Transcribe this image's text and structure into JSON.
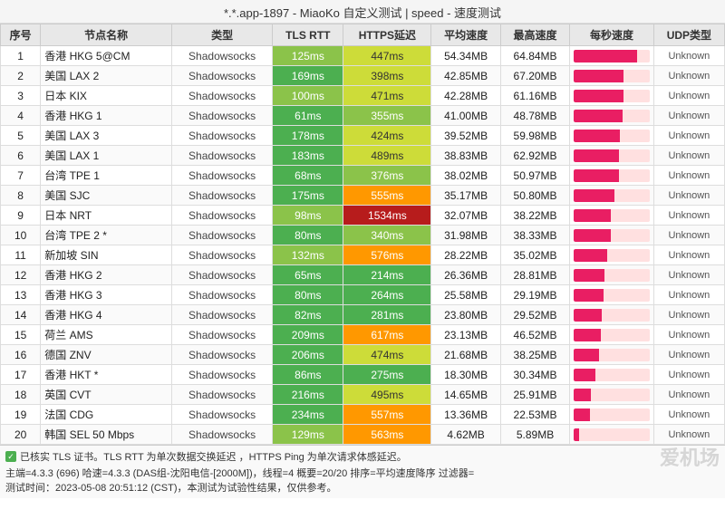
{
  "title": "*.*.app-1897 - MiaoKo 自定义测试 | speed - 速度测试",
  "columns": [
    "序号",
    "节点名称",
    "类型",
    "TLS RTT",
    "HTTPS延迟",
    "平均速度",
    "最高速度",
    "每秒速度",
    "UDP类型"
  ],
  "rows": [
    {
      "id": 1,
      "name": "香港 HKG 5@CM",
      "type": "Shadowsocks",
      "tls": "125ms",
      "tls_class": "tls-lightgreen",
      "https": "447ms",
      "https_class": "https-yellow",
      "avg": "54.34MB",
      "max": "64.84MB",
      "bar_pct": 84,
      "udp": "Unknown"
    },
    {
      "id": 2,
      "name": "美国 LAX 2",
      "type": "Shadowsocks",
      "tls": "169ms",
      "tls_class": "tls-green",
      "https": "398ms",
      "https_class": "https-yellow",
      "avg": "42.85MB",
      "max": "67.20MB",
      "bar_pct": 66,
      "udp": "Unknown"
    },
    {
      "id": 3,
      "name": "日本 KIX",
      "type": "Shadowsocks",
      "tls": "100ms",
      "tls_class": "tls-lightgreen",
      "https": "471ms",
      "https_class": "https-yellow",
      "avg": "42.28MB",
      "max": "61.16MB",
      "bar_pct": 65,
      "udp": "Unknown"
    },
    {
      "id": 4,
      "name": "香港 HKG 1",
      "type": "Shadowsocks",
      "tls": "61ms",
      "tls_class": "tls-green",
      "https": "355ms",
      "https_class": "https-lightgreen",
      "avg": "41.00MB",
      "max": "48.78MB",
      "bar_pct": 64,
      "udp": "Unknown"
    },
    {
      "id": 5,
      "name": "美国 LAX 3",
      "type": "Shadowsocks",
      "tls": "178ms",
      "tls_class": "tls-green",
      "https": "424ms",
      "https_class": "https-yellow",
      "avg": "39.52MB",
      "max": "59.98MB",
      "bar_pct": 61,
      "udp": "Unknown"
    },
    {
      "id": 6,
      "name": "美国 LAX 1",
      "type": "Shadowsocks",
      "tls": "183ms",
      "tls_class": "tls-green",
      "https": "489ms",
      "https_class": "https-yellow",
      "avg": "38.83MB",
      "max": "62.92MB",
      "bar_pct": 60,
      "udp": "Unknown"
    },
    {
      "id": 7,
      "name": "台湾 TPE 1",
      "type": "Shadowsocks",
      "tls": "68ms",
      "tls_class": "tls-green",
      "https": "376ms",
      "https_class": "https-lightgreen",
      "avg": "38.02MB",
      "max": "50.97MB",
      "bar_pct": 59,
      "udp": "Unknown"
    },
    {
      "id": 8,
      "name": "美国 SJC",
      "type": "Shadowsocks",
      "tls": "175ms",
      "tls_class": "tls-green",
      "https": "555ms",
      "https_class": "https-orange",
      "avg": "35.17MB",
      "max": "50.80MB",
      "bar_pct": 54,
      "udp": "Unknown"
    },
    {
      "id": 9,
      "name": "日本 NRT",
      "type": "Shadowsocks",
      "tls": "98ms",
      "tls_class": "tls-lightgreen",
      "https": "1534ms",
      "https_class": "https-darkred",
      "avg": "32.07MB",
      "max": "38.22MB",
      "bar_pct": 49,
      "udp": "Unknown"
    },
    {
      "id": 10,
      "name": "台湾 TPE 2 *",
      "type": "Shadowsocks",
      "tls": "80ms",
      "tls_class": "tls-green",
      "https": "340ms",
      "https_class": "https-lightgreen",
      "avg": "31.98MB",
      "max": "38.33MB",
      "bar_pct": 49,
      "udp": "Unknown"
    },
    {
      "id": 11,
      "name": "新加坡 SIN",
      "type": "Shadowsocks",
      "tls": "132ms",
      "tls_class": "tls-lightgreen",
      "https": "576ms",
      "https_class": "https-orange",
      "avg": "28.22MB",
      "max": "35.02MB",
      "bar_pct": 44,
      "udp": "Unknown"
    },
    {
      "id": 12,
      "name": "香港 HKG 2",
      "type": "Shadowsocks",
      "tls": "65ms",
      "tls_class": "tls-green",
      "https": "214ms",
      "https_class": "https-green",
      "avg": "26.36MB",
      "max": "28.81MB",
      "bar_pct": 41,
      "udp": "Unknown"
    },
    {
      "id": 13,
      "name": "香港 HKG 3",
      "type": "Shadowsocks",
      "tls": "80ms",
      "tls_class": "tls-green",
      "https": "264ms",
      "https_class": "https-green",
      "avg": "25.58MB",
      "max": "29.19MB",
      "bar_pct": 39,
      "udp": "Unknown"
    },
    {
      "id": 14,
      "name": "香港 HKG 4",
      "type": "Shadowsocks",
      "tls": "82ms",
      "tls_class": "tls-green",
      "https": "281ms",
      "https_class": "https-green",
      "avg": "23.80MB",
      "max": "29.52MB",
      "bar_pct": 37,
      "udp": "Unknown"
    },
    {
      "id": 15,
      "name": "荷兰 AMS",
      "type": "Shadowsocks",
      "tls": "209ms",
      "tls_class": "tls-green",
      "https": "617ms",
      "https_class": "https-orange",
      "avg": "23.13MB",
      "max": "46.52MB",
      "bar_pct": 36,
      "udp": "Unknown"
    },
    {
      "id": 16,
      "name": "德国 ZNV",
      "type": "Shadowsocks",
      "tls": "206ms",
      "tls_class": "tls-green",
      "https": "474ms",
      "https_class": "https-yellow",
      "avg": "21.68MB",
      "max": "38.25MB",
      "bar_pct": 33,
      "udp": "Unknown"
    },
    {
      "id": 17,
      "name": "香港 HKT *",
      "type": "Shadowsocks",
      "tls": "86ms",
      "tls_class": "tls-green",
      "https": "275ms",
      "https_class": "https-green",
      "avg": "18.30MB",
      "max": "30.34MB",
      "bar_pct": 28,
      "udp": "Unknown"
    },
    {
      "id": 18,
      "name": "英国 CVT",
      "type": "Shadowsocks",
      "tls": "216ms",
      "tls_class": "tls-green",
      "https": "495ms",
      "https_class": "https-yellow",
      "avg": "14.65MB",
      "max": "25.91MB",
      "bar_pct": 23,
      "udp": "Unknown"
    },
    {
      "id": 19,
      "name": "法国 CDG",
      "type": "Shadowsocks",
      "tls": "234ms",
      "tls_class": "tls-green",
      "https": "557ms",
      "https_class": "https-orange",
      "avg": "13.36MB",
      "max": "22.53MB",
      "bar_pct": 21,
      "udp": "Unknown"
    },
    {
      "id": 20,
      "name": "韩国 SEL 50 Mbps",
      "type": "Shadowsocks",
      "tls": "129ms",
      "tls_class": "tls-lightgreen",
      "https": "563ms",
      "https_class": "https-orange",
      "avg": "4.62MB",
      "max": "5.89MB",
      "bar_pct": 7,
      "udp": "Unknown"
    }
  ],
  "footer": {
    "checkbox_text": "已核实 TLS 证书。TLS RTT 为单次数据交换延迟 ，HTTPS Ping 为单次请求体感延迟。",
    "line2": "主端=4.3.3 (696) 哈速=4.3.3 (DAS组-沈阳电信-[2000M])，线程=4 概要=20/20 排序=平均速度降序 过滤器=",
    "line3": "测试时间：2023-05-08 20:51:12 (CST)，本测试为试验性结果，仅供参考。"
  },
  "watermark": "爱机场"
}
